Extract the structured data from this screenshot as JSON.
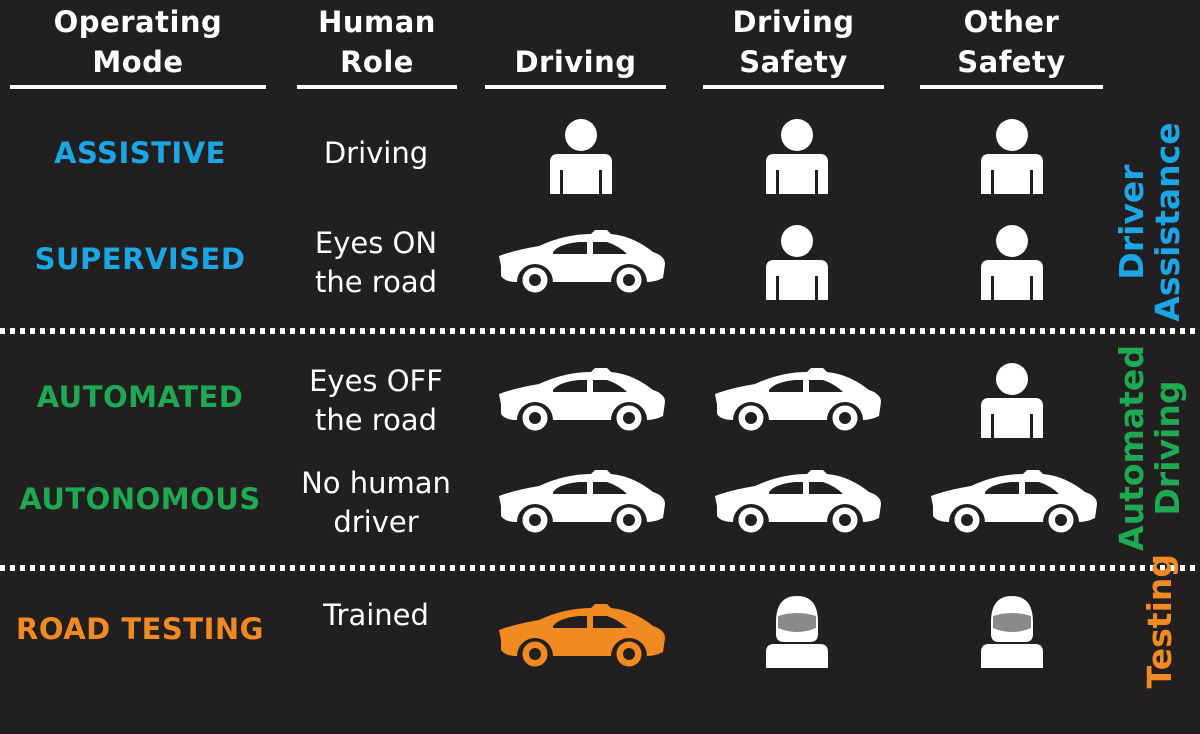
{
  "colors": {
    "background": "#221f20",
    "text": "#ffffff",
    "driver_assistance": "#1ba6e5",
    "automated_driving": "#1eaa50",
    "testing": "#f28a22",
    "visor": "#8a8a8a"
  },
  "headers": {
    "operating_mode": [
      "Operating",
      "Mode"
    ],
    "human_role": [
      "Human",
      "Role"
    ],
    "driving": [
      "Driving"
    ],
    "driving_safety": [
      "Driving",
      "Safety"
    ],
    "other_safety": [
      "Other",
      "Safety"
    ]
  },
  "rows": [
    {
      "mode": "ASSISTIVE",
      "role": [
        "Driving"
      ],
      "driving": "person-icon",
      "driving_safety": "person-icon",
      "other_safety": "person-icon",
      "group": "driver_assistance"
    },
    {
      "mode": "SUPERVISED",
      "role": [
        "Eyes ON",
        "the road"
      ],
      "driving": "car-icon",
      "driving_safety": "person-icon",
      "other_safety": "person-icon",
      "group": "driver_assistance"
    },
    {
      "mode": "AUTOMATED",
      "role": [
        "Eyes OFF",
        "the road"
      ],
      "driving": "car-icon",
      "driving_safety": "car-icon",
      "other_safety": "person-icon",
      "group": "automated_driving"
    },
    {
      "mode": "AUTONOMOUS",
      "role": [
        "No human",
        "driver"
      ],
      "driving": "car-icon",
      "driving_safety": "car-icon",
      "other_safety": "car-icon",
      "group": "automated_driving"
    },
    {
      "mode": "ROAD TESTING",
      "role": [
        "Trained"
      ],
      "driving": "car-icon",
      "driving_safety": "helmet-person-icon",
      "other_safety": "helmet-person-icon",
      "group": "testing"
    }
  ],
  "groups": {
    "driver_assistance": [
      "Driver",
      "Assistance"
    ],
    "automated_driving": [
      "Automated",
      "Driving"
    ],
    "testing": [
      "Testing"
    ]
  }
}
